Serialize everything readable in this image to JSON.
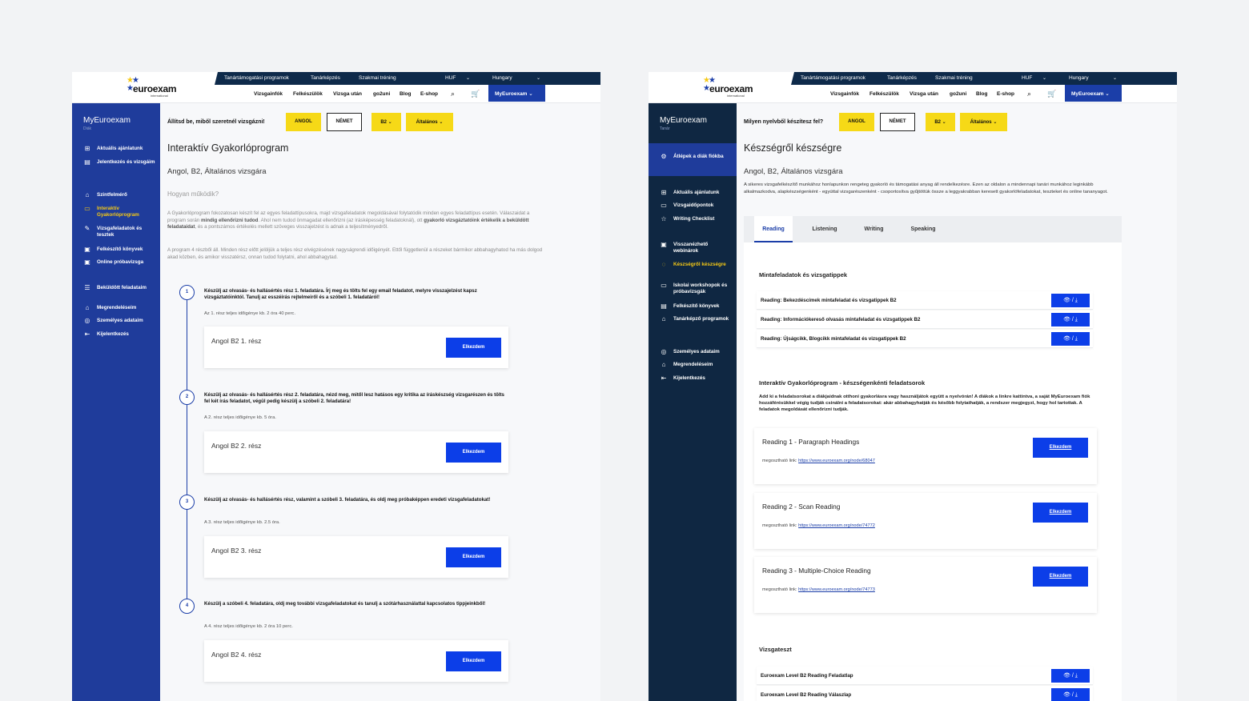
{
  "header": {
    "logo_text": "euroexam",
    "logo_sub": "international",
    "top_links": [
      "Tanártámogatási programok",
      "Tanárképzés",
      "Szakmai tréning"
    ],
    "currency": "HUF",
    "country": "Hungary",
    "nav_links": [
      "Vizsgainfók",
      "Felkészülök",
      "Vizsga után",
      "go2uni",
      "Blog",
      "E-shop"
    ],
    "account_label": "MyEuroexam"
  },
  "left": {
    "sidebar": {
      "title": "MyEuroexam",
      "subtitle": "Diák",
      "items": [
        "Aktuális ajánlatunk",
        "Jelentkezés és vizsgáim",
        "Szintfelmérő",
        "Interaktív Gyakorlóprogram",
        "Vizsgafeladatok és tesztek",
        "Felkészítő könyvek",
        "Online próbavizsga",
        "Beküldött feladataim",
        "Megrendeléseim",
        "Személyes adataim",
        "Kijelentkezés"
      ]
    },
    "filter": {
      "label": "Állítsd be, miből szeretnél vizsgázni!",
      "lang1": "ANGOL",
      "lang2": "NÉMET",
      "level": "B2",
      "type": "Általános"
    },
    "title": "Interaktív Gyakorlóprogram",
    "subtitle": "Angol, B2, Általános vizsgára",
    "how": "Hogyan működik?",
    "para1a": "A Gyakorlóprogram fokozatosan készít fel az egyes feladattípusokra, majd vizsgafeladatok megoldásával folytatódik minden egyes feladattípus esetén. Válaszaidat a program során ",
    "para1b": "mindig ellenőrizni tudod",
    "para1c": ". Ahol nem tudod önmagadat ellenőrizni (az írásképesség feladatoknál), ott ",
    "para1d": "gyakorló vizsgáztatóink értékelik a beküldött feladataidat",
    "para1e": ", és a pontszámos értékelés mellett szöveges visszajelzést is adnak a teljesítményedről.",
    "para2": "A program 4 részből áll. Minden rész előtt jelöljük a teljes rész elvégzésének nagyságrendi időigényét. Ettől függetlenül a részeket bármikor abbahagyhatod ha más dolgod akad közben, és amikor visszatérsz, onnan tudod folytatni, ahol abbahagytad.",
    "steps": [
      {
        "num": "1",
        "title": "Készülj az olvasás- és hallásértés rész 1. feladatára. Írj meg és tölts fel egy email feladatot, melyre visszajelzést kapsz vizsgáztatóinktól. Tanulj az esszéírás rejtelmeiről és a szóbeli 1. feladatáról!",
        "time": "Az 1. rész teljes időigénye kb. 2 óra 40 perc.",
        "card": "Angol B2 1. rész",
        "btn": "Elkezdem"
      },
      {
        "num": "2",
        "title": "Készülj az olvasás- és hallásértés rész 2. feladatára, nézd meg, mitől lesz hatásos egy kritika az íráskészség vizsgarészen és tölts fel két írás feladatot, végül pedig készülj a szóbeli 2. feladatára!",
        "time": "A 2. rész teljes időigénye kb. 5 óra.",
        "card": "Angol B2 2. rész",
        "btn": "Elkezdem"
      },
      {
        "num": "3",
        "title": "Készülj az olvasás- és hallásértés rész, valamint a szóbeli 3. feladatára, és oldj meg próbaképpen eredeti vizsgafeladatokat!",
        "time": "A 3. rész teljes időigénye kb. 2.5 óra.",
        "card": "Angol B2 3. rész",
        "btn": "Elkezdem"
      },
      {
        "num": "4",
        "title": "Készülj a szóbeli 4. feladatára, oldj meg további vizsgafeladatokat és tanulj a szótárhasználattal kapcsolatos tippjeinkből!",
        "time": "A 4. rész teljes időigénye kb. 2 óra 10 perc.",
        "card": "Angol B2 4. rész",
        "btn": "Elkezdem"
      }
    ]
  },
  "right": {
    "sidebar": {
      "title": "MyEuroexam",
      "subtitle": "Tanár",
      "featured": "Átlépek a diák fiókba",
      "items": [
        "Aktuális ajánlatunk",
        "Vizsgaidőpontok",
        "Writing Checklist",
        "Visszanézhető webinárok",
        "Készségről készségre",
        "Iskolai workshopok és próbavizsgák",
        "Felkészítő könyvek",
        "Tanárképző programok",
        "Személyes adataim",
        "Megrendeléseim",
        "Kijelentkezés"
      ]
    },
    "filter": {
      "label": "Milyen nyelvből készítesz fel?",
      "lang1": "ANGOL",
      "lang2": "NÉMET",
      "level": "B2",
      "type": "Általános"
    },
    "title": "Készségről készségre",
    "subtitle": "Angol, B2, Általános vizsgára",
    "intro": "A sikeres vizsgafelkészítő munkához honlapunkon rengeteg gyakorló és támogatási anyag áll rendelkezésre. Ezen az oldalon a mindennapi tanári munkához leginkább alkalmazkodva, alapkészségenként - egyúttal vizsgarészenként - csoportosítva gyűjtöttük össze a leggyakrabban keresett gyakorlófeladatokat, teszteket és online tananyagot.",
    "tabs": [
      "Reading",
      "Listening",
      "Writing",
      "Speaking"
    ],
    "section1": "Mintafeladatok és vizsgatippek",
    "rows1": [
      "Reading: Bekezdéscímek mintafeladat és vizsgatippek B2",
      "Reading: Információkereső olvasás mintafeladat és vizsgatippek B2",
      "Reading: Újságcikk, Blogcikk mintafeladat és vizsgatippek B2"
    ],
    "icon_btn": "👁 / ⤓",
    "section2": "Interaktív Gyakorlóprogram - készségenkénti feladatsorok",
    "section2_desc": "Add ki a feladatsorokat a diákjaidnak otthoni gyakorlásra vagy használjátok együtt a nyelvórán! A diákok a linkre kattintva, a saját MyEuroexam fiók hozzáférésükkel végig tudják csinálni a feladatsorokat: akár abbahagyhatják és később folytathatják, a rendszer megjegyzi, hogy hol tartottak. A feladatok megoldását ellenőrizni tudják.",
    "practice": [
      {
        "title": "Reading 1 - Paragraph Headings",
        "link_label": "megosztható link:",
        "link": "https://www.euroexam.org/node/68047",
        "btn": "Elkezdem"
      },
      {
        "title": "Reading 2 - Scan Reading",
        "link_label": "megosztható link:",
        "link": "https://www.euroexam.org/node/74772",
        "btn": "Elkezdem"
      },
      {
        "title": "Reading 3 - Multiple-Choice Reading",
        "link_label": "megosztható link:",
        "link": "https://www.euroexam.org/node/74773",
        "btn": "Elkezdem"
      }
    ],
    "section3": "Vizsgateszt",
    "rows3": [
      "Euroexam Level B2 Reading Feladatlap",
      "Euroexam Level B2 Reading Válaszlap"
    ]
  },
  "colors": {
    "brand_blue": "#1b3ea8",
    "button_blue": "#0c3ee8",
    "yellow": "#f6d917",
    "navy": "#0f2742"
  }
}
